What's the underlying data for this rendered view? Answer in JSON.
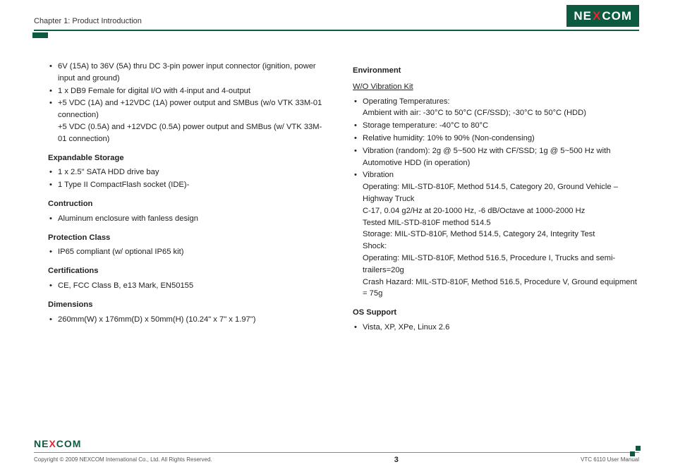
{
  "header": {
    "chapter": "Chapter 1: Product Introduction",
    "logo_pre": "NE",
    "logo_x": "X",
    "logo_post": "COM"
  },
  "left": {
    "top_items": [
      "6V (15A) to 36V (5A) thru DC 3-pin power input connector (ignition, power input and ground)",
      "1 x DB9 Female for digital I/O with 4-input and 4-output",
      "+5 VDC (1A) and +12VDC (1A) power output and SMBus (w/o VTK 33M-01 connection)\n+5 VDC (0.5A) and +12VDC (0.5A) power output and SMBus (w/ VTK 33M-01 connection)"
    ],
    "expandable_heading": "Expandable Storage",
    "expandable_items": [
      "1 x 2.5\" SATA HDD drive bay",
      "1 Type II CompactFlash socket (IDE)-"
    ],
    "construction_heading": "Contruction",
    "construction_items": [
      "Aluminum enclosure with fanless design"
    ],
    "protection_heading": "Protection Class",
    "protection_items": [
      "IP65 compliant (w/ optional IP65 kit)"
    ],
    "cert_heading": "Certifications",
    "cert_items": [
      "CE, FCC Class B, e13 Mark, EN50155"
    ],
    "dim_heading": "Dimensions",
    "dim_items": [
      "260mm(W) x 176mm(D) x 50mm(H) (10.24\" x 7\" x 1.97\")"
    ]
  },
  "right": {
    "env_heading": "Environment",
    "env_sub": "W/O Vibration Kit",
    "env_items": [
      "Operating Temperatures:\nAmbient with air: -30°C to 50°C (CF/SSD); -30°C to 50°C (HDD)",
      "Storage temperature: -40°C to 80°C",
      "Relative humidity: 10% to 90% (Non-condensing)",
      "Vibration (random): 2g @ 5~500 Hz with CF/SSD; 1g @ 5~500 Hz with Automotive HDD (in operation)",
      "Vibration\nOperating: MIL-STD-810F, Method 514.5, Category 20, Ground Vehicle – Highway Truck\nC-17, 0.04 g2/Hz at 20-1000 Hz, -6 dB/Octave at 1000-2000 Hz\nTested MIL-STD-810F method 514.5\nStorage: MIL-STD-810F, Method 514.5, Category 24, Integrity Test\nShock:\nOperating: MIL-STD-810F, Method 516.5, Procedure I, Trucks and semi-trailers=20g\nCrash Hazard: MIL-STD-810F, Method 516.5, Procedure V, Ground equipment = 75g"
    ],
    "os_heading": "OS Support",
    "os_items": [
      "Vista, XP, XPe, Linux 2.6"
    ]
  },
  "footer": {
    "copyright": "Copyright © 2009 NEXCOM International Co., Ltd. All Rights Reserved.",
    "page": "3",
    "manual": "VTC 6110 User Manual",
    "logo_pre": "NE",
    "logo_x": "X",
    "logo_post": "COM"
  }
}
